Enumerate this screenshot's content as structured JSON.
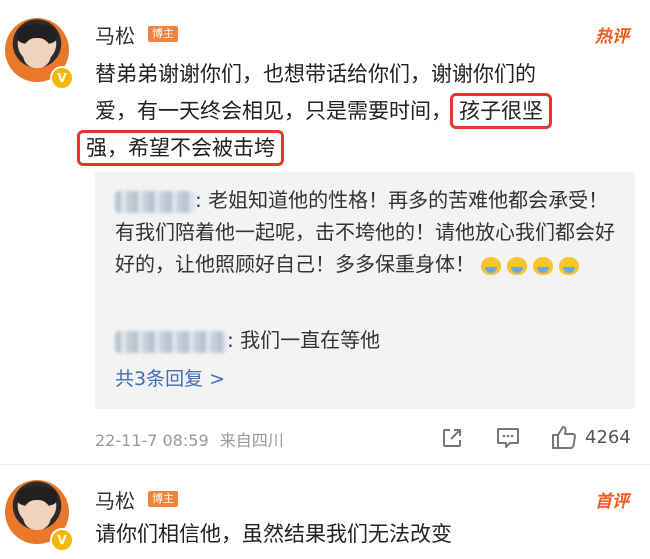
{
  "comment1": {
    "username": "马松",
    "badge": "博主",
    "tag": "热评",
    "line1": "替弟弟谢谢你们，也想带话给你们，谢谢你们的",
    "line2_pre": "爱，有一天终会相见，只是需要时间，",
    "line2_hl": "孩子很坚",
    "line3_hl": "强，希望不会被击垮",
    "replies": [
      {
        "text": "老姐知道他的性格！再多的苦难他都会承受！有我们陪着他一起呢，击不垮他的！请他放心我们都会好好的，让他照顾好自己！多多保重身体！"
      },
      {
        "text": "我们一直在等他"
      }
    ],
    "more_replies": "共3条回复 >",
    "timestamp": "22-11-7 08:59",
    "location": "来自四川",
    "likes": "4264"
  },
  "comment2": {
    "username": "马松",
    "badge": "博主",
    "tag": "首评",
    "content": "请你们相信他，虽然结果我们无法改变"
  },
  "colors": {
    "highlight_border": "#e3382f",
    "tag_hot": "#f35a1f",
    "link": "#3f6fb5",
    "badge_bg": "#f0853a"
  }
}
